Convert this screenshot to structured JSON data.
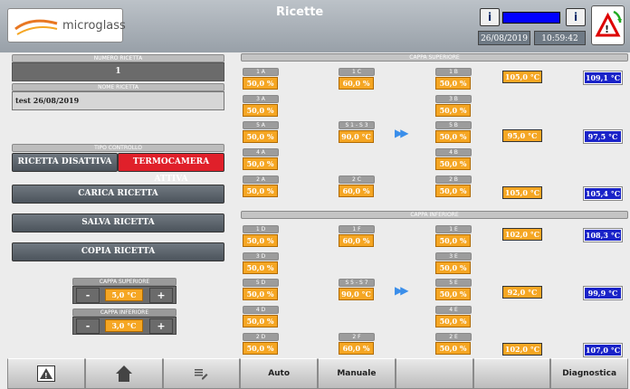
{
  "header": {
    "brand": "microglass",
    "title": "Ricette",
    "date": "26/08/2019",
    "time": "10:59:42",
    "info1": "i",
    "info2": "i"
  },
  "left": {
    "numero_ricetta_label": "NUMERO RICETTA",
    "numero_ricetta": "1",
    "nome_ricetta_label": "NOME RICETTA",
    "nome_ricetta": "test 26/08/2019",
    "tipo_controllo_label": "TIPO CONTROLLO",
    "ricetta_disattiva": "RICETTA DISATTIVA",
    "termocamera_attiva": "TERMOCAMERA ATTIVA",
    "carica": "CARICA RICETTA",
    "salva": "SALVA RICETTA",
    "copia": "COPIA RICETTA",
    "cappa_sup_label": "CAPPA SUPERIORE",
    "cappa_sup_val": "5,0 °C",
    "cappa_inf_label": "CAPPA INFERIORE",
    "cappa_inf_val": "3,0 °C",
    "minus": "-",
    "plus": "+"
  },
  "upper": {
    "title": "CAPPA SUPERIORE",
    "rows": [
      {
        "a": "1 A",
        "av": "50,0 %",
        "c": "1 C",
        "cv": "60,0 %",
        "b": "1 B",
        "bv": "50,0 %"
      },
      {
        "a": "3 A",
        "av": "50,0 %",
        "b": "3 B",
        "bv": "50,0 %"
      },
      {
        "a": "5 A",
        "av": "50,0 %",
        "c": "S 1 - S 3",
        "cv": "90,0 °C",
        "b": "5 B",
        "bv": "50,0 %"
      },
      {
        "a": "4 A",
        "av": "50,0 %",
        "b": "4 B",
        "bv": "50,0 %"
      },
      {
        "a": "2 A",
        "av": "50,0 %",
        "c": "2 C",
        "cv": "60,0 %",
        "b": "2 B",
        "bv": "50,0 %"
      }
    ],
    "temps": [
      {
        "set": "105,0 °C",
        "act": "109,1 °C"
      },
      {
        "set": "95,0 °C",
        "act": "97,5 °C"
      },
      {
        "set": "105,0 °C",
        "act": "105,4 °C"
      }
    ]
  },
  "lower": {
    "title": "CAPPA INFERIORE",
    "rows": [
      {
        "a": "1 D",
        "av": "50,0 %",
        "c": "1 F",
        "cv": "60,0 %",
        "b": "1 E",
        "bv": "50,0 %"
      },
      {
        "a": "3 D",
        "av": "50,0 %",
        "b": "3 E",
        "bv": "50,0 %"
      },
      {
        "a": "5 D",
        "av": "50,0 %",
        "c": "S 5 - S 7",
        "cv": "90,0 °C",
        "b": "5 E",
        "bv": "50,0 %"
      },
      {
        "a": "4 D",
        "av": "50,0 %",
        "b": "4 E",
        "bv": "50,0 %"
      },
      {
        "a": "2 D",
        "av": "50,0 %",
        "c": "2 F",
        "cv": "60,0 %",
        "b": "2 E",
        "bv": "50,0 %"
      }
    ],
    "temps": [
      {
        "set": "102,0 °C",
        "act": "108,3 °C"
      },
      {
        "set": "92,0 °C",
        "act": "99,9 °C"
      },
      {
        "set": "102,0 °C",
        "act": "107,0 °C"
      }
    ]
  },
  "nav": {
    "auto": "Auto",
    "manuale": "Manuale",
    "diagnostica": "Diagnostica"
  },
  "icons": [
    "alarm-icon",
    "home-icon",
    "list-edit-icon"
  ]
}
